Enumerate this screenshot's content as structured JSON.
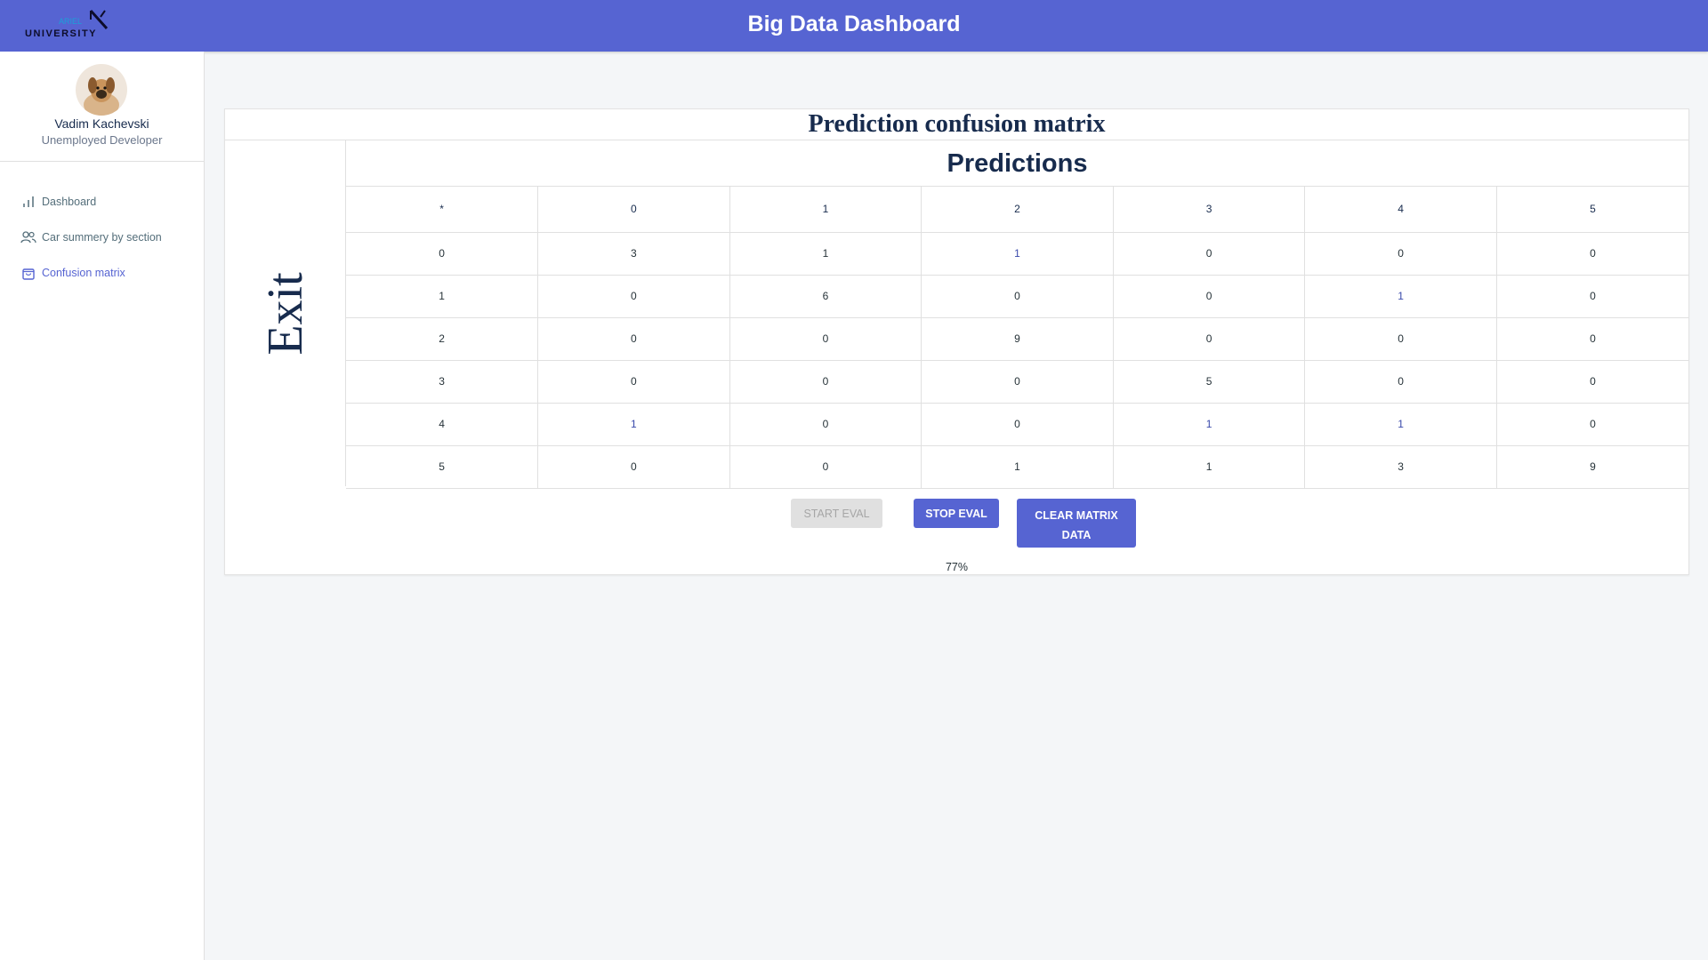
{
  "header": {
    "logo": {
      "small_text": "ARIEL",
      "main_text": "UNIVERSITY",
      "alt": "Ariel University logo"
    },
    "title": "Big Data Dashboard"
  },
  "sidebar": {
    "user": {
      "name": "Vadim Kachevski",
      "role": "Unemployed Developer"
    },
    "items": [
      {
        "label": "Dashboard",
        "icon": "bar-chart-icon",
        "active": false
      },
      {
        "label": "Car summery by section",
        "icon": "users-icon",
        "active": false
      },
      {
        "label": "Confusion matrix",
        "icon": "shopping-bag-icon",
        "active": true
      }
    ]
  },
  "card": {
    "title": "Prediction confusion matrix",
    "row_axis_label": "Exit",
    "col_axis_label": "Predictions",
    "matrix": {
      "corner": "*",
      "columns": [
        "0",
        "1",
        "2",
        "3",
        "4",
        "5"
      ],
      "rows": [
        {
          "label": "0",
          "values": [
            "3",
            "1",
            "1",
            "0",
            "0",
            "0"
          ]
        },
        {
          "label": "1",
          "values": [
            "0",
            "6",
            "0",
            "0",
            "1",
            "0"
          ]
        },
        {
          "label": "2",
          "values": [
            "0",
            "0",
            "9",
            "0",
            "0",
            "0"
          ]
        },
        {
          "label": "3",
          "values": [
            "0",
            "0",
            "0",
            "5",
            "0",
            "0"
          ]
        },
        {
          "label": "4",
          "values": [
            "1",
            "0",
            "0",
            "1",
            "1",
            "0"
          ]
        },
        {
          "label": "5",
          "values": [
            "0",
            "0",
            "1",
            "1",
            "3",
            "9"
          ]
        }
      ]
    },
    "buttons": {
      "start": {
        "label": "START EVAL",
        "disabled": true
      },
      "stop": {
        "label": "STOP EVAL",
        "disabled": false
      },
      "clear_line1": "CLEAR MATRIX",
      "clear_line2": "DATA"
    },
    "accuracy": "77%"
  },
  "colors": {
    "primary": "#5664d2",
    "background": "#f4f6f8",
    "text": "#172b4d",
    "disabled": "#e0e0e0"
  }
}
